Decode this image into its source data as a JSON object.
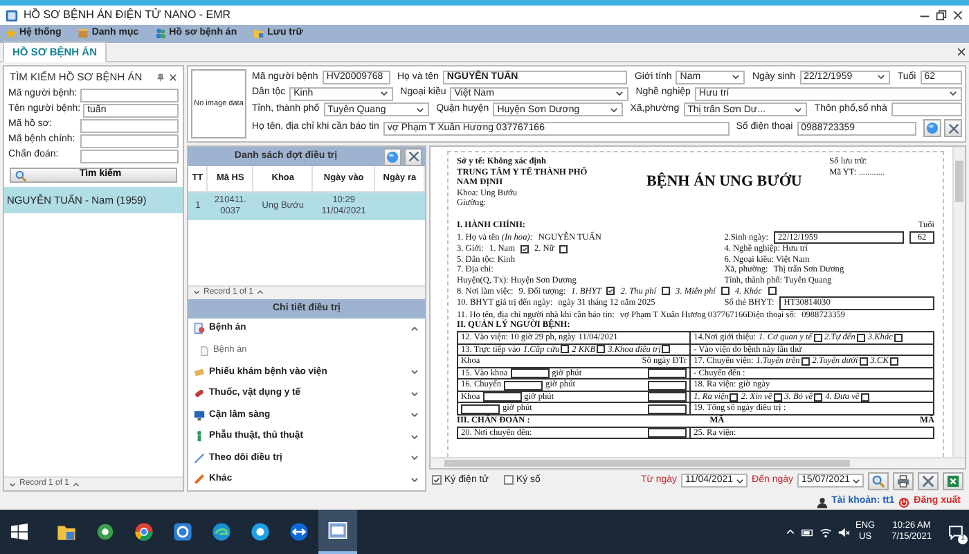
{
  "window": {
    "title": "HỒ SƠ BỆNH ÁN ĐIỆN TỬ NANO - EMR"
  },
  "menu": [
    {
      "label": "Hệ thống",
      "kind": "star"
    },
    {
      "label": "Danh mục",
      "kind": "book"
    },
    {
      "label": "Hồ sơ bệnh án",
      "kind": "people"
    },
    {
      "label": "Lưu trữ",
      "kind": "folder"
    }
  ],
  "tabs": [
    {
      "label": "HỒ SƠ BỆNH ÁN",
      "selected": true
    }
  ],
  "search_panel": {
    "title": "TÌM KIẾM HỒ SƠ BỆNH ÁN",
    "fields": [
      {
        "label": "Mã người bệnh:"
      },
      {
        "label": "Tên người bệnh:",
        "value": "tuấn"
      },
      {
        "label": "Mã hồ sơ:"
      },
      {
        "label": "Mã bệnh chính:"
      },
      {
        "label": "Chẩn đoán:"
      }
    ],
    "search_button": "Tìm kiếm",
    "results": [
      {
        "label": "NGUYỄN TUẤN - Nam (1959)",
        "selected": true
      }
    ],
    "pager": "Record 1 of 1"
  },
  "patient": {
    "photo": "No image data",
    "rows": [
      [
        {
          "label": "Mã người bệnh",
          "value": "HV20009768",
          "kind": "text"
        },
        {
          "label": "Họ và tên",
          "value": "NGUYỄN TUẤN",
          "kind": "text",
          "bold": true
        },
        {
          "label": "Giới tính",
          "value": "Nam",
          "kind": "select"
        },
        {
          "label": "Ngày sinh",
          "value": "22/12/1959",
          "kind": "select"
        },
        {
          "label": "Tuổi",
          "value": "62",
          "kind": "text"
        }
      ],
      [
        {
          "label": "Dân tộc",
          "value": "Kinh",
          "kind": "select"
        },
        {
          "label": "Ngoại kiều",
          "value": "Việt Nam",
          "kind": "select"
        },
        {
          "label": "Nghề nghiệp",
          "value": "Hưu trí",
          "kind": "select"
        }
      ],
      [
        {
          "label": "Tỉnh, thành phố",
          "value": "Tuyên Quang",
          "kind": "select"
        },
        {
          "label": "Quận huyện",
          "value": "Huyện Sơn Dương",
          "kind": "select"
        },
        {
          "label": "Xã,phường",
          "value": "Thị trấn Sơn Dư...",
          "kind": "select"
        },
        {
          "label": "Thôn phố,số nhà",
          "kind": "text"
        }
      ],
      [
        {
          "label": "Họ tên, địa chỉ khi cần báo tin",
          "value": "vợ Phạm T Xuân Hương 037767166",
          "kind": "text"
        },
        {
          "label": "Số điện thoại",
          "value": "0988723359",
          "kind": "text"
        }
      ]
    ]
  },
  "treatments": {
    "title": "Danh sách đợt điều trị",
    "columns": [
      "TT",
      "Mã HS",
      "Khoa",
      "Ngày vào",
      "Ngày ra"
    ],
    "rows": [
      {
        "cells": [
          "1",
          "210411.\n0037",
          "Ung Bướu",
          "10:29\n11/04/2021"
        ],
        "selected": true
      }
    ],
    "pager": "Record 1 of 1"
  },
  "details": {
    "title": "Chi tiết điều trị",
    "sections": [
      {
        "label": "Bệnh án",
        "kind": "record",
        "expanded": true,
        "children": [
          {
            "label": "Bệnh án"
          }
        ]
      },
      {
        "label": "Phiếu khám bệnh vào viện",
        "kind": "note",
        "expanded": false
      },
      {
        "label": "Thuốc, vật dụng y tế",
        "kind": "pill",
        "expanded": false
      },
      {
        "label": "Cận lâm sàng",
        "kind": "monitor",
        "expanded": false
      },
      {
        "label": "Phẫu thuật, thủ thuật",
        "kind": "figure",
        "expanded": false
      },
      {
        "label": "Theo dõi điều trị",
        "kind": "pen",
        "expanded": false
      },
      {
        "label": "Khác",
        "kind": "ruler",
        "expanded": false
      }
    ]
  },
  "document": {
    "header_left": [
      {
        "kind": "bold",
        "text": "Sở y tế: Không xác định"
      },
      {
        "kind": "bold",
        "text": "TRUNG TÂM Y TẾ THÀNH PHỐ"
      },
      {
        "kind": "bold",
        "text": "NAM ĐỊNH"
      },
      {
        "kind": "text",
        "text": "Khoa: Ung Bướu"
      },
      {
        "kind": "text",
        "text": "Giường:"
      }
    ],
    "title": "BỆNH ÁN UNG BƯỚU",
    "header_right": [
      {
        "kind": "text",
        "text": "Số lưu trữ:"
      },
      {
        "kind": "text",
        "text": "Mã YT: ............"
      }
    ],
    "lines": [
      {
        "kind": "plain",
        "left": [
          {
            "kind": "bold",
            "text": "I. HÀNH CHÍNH:"
          }
        ],
        "right": [
          {
            "kind": "end",
            "text": "Tuổi"
          }
        ]
      },
      {
        "kind": "plain",
        "left": [
          {
            "kind": "text",
            "text": "1. Họ và tên *(In hoa):*"
          },
          {
            "kind": "text",
            "text": "NGUYỄN TUẤN"
          }
        ],
        "right": [
          {
            "kind": "text",
            "text": "2.Sinh ngày:"
          },
          {
            "kind": "field",
            "text": "22/12/1959"
          },
          {
            "kind": "box",
            "text": "62"
          }
        ]
      },
      {
        "kind": "plain",
        "left": [
          {
            "kind": "text",
            "text": "3. Giới:"
          },
          {
            "kind": "check",
            "text": "1. Nam",
            "checked": true
          },
          {
            "kind": "check",
            "text": "2. Nữ",
            "checked": false
          }
        ],
        "right": [
          {
            "kind": "text",
            "text": "4. Nghề nghiệp: Hưu trí"
          }
        ]
      },
      {
        "kind": "plain",
        "left": [
          {
            "kind": "text",
            "text": "5. Dân tộc: Kinh"
          }
        ],
        "right": [
          {
            "kind": "text",
            "text": "6. Ngoại kiều: Việt Nam"
          }
        ]
      },
      {
        "kind": "plain",
        "left": [
          {
            "kind": "text",
            "text": "7. Địa chỉ:"
          }
        ],
        "right": [
          {
            "kind": "text",
            "text": "Xã, phường:"
          },
          {
            "kind": "text",
            "text": "Thị trấn Sơn Dương"
          }
        ]
      },
      {
        "kind": "plain",
        "left": [
          {
            "kind": "text",
            "text": "Huyện(Q, Tx): Huyện Sơn Dương"
          }
        ],
        "right": [
          {
            "kind": "text",
            "text": "Tỉnh, thành phố: Tuyên Quang"
          }
        ]
      },
      {
        "kind": "plain",
        "left": [
          {
            "kind": "text",
            "text": "8. Nơi làm việc:"
          },
          {
            "kind": "end",
            "text": "9. Đối tượng:"
          },
          {
            "kind": "check_italic",
            "text": "1. BHYT",
            "checked": true
          },
          {
            "kind": "check_italic",
            "text": "2. Thu phí",
            "checked": false
          },
          {
            "kind": "check_italic",
            "text": "3. Miễn phí",
            "checked": false
          },
          {
            "kind": "check_italic",
            "text": "4. Khác",
            "checked": false
          }
        ]
      },
      {
        "kind": "plain",
        "left": [
          {
            "kind": "text",
            "text": "10. BHYT giá trị đến ngày:"
          },
          {
            "kind": "text",
            "text": "ngày 31 tháng 12 năm 2025"
          }
        ],
        "right": [
          {
            "kind": "text",
            "text": "Số thẻ BHYT:"
          },
          {
            "kind": "field",
            "text": "HT30814030"
          }
        ]
      },
      {
        "kind": "plain",
        "left": [
          {
            "kind": "text",
            "text": "11. Họ tên, địa chỉ người nhà khi cần báo tin:"
          },
          {
            "kind": "text",
            "text": "vợ Phạm T Xuân Hương 037767166"
          }
        ],
        "right": [
          {
            "kind": "text",
            "text": "Điện thoại số:"
          },
          {
            "kind": "text",
            "text": "0988723359"
          }
        ]
      },
      {
        "kind": "plain",
        "left": [
          {
            "kind": "bold",
            "text": "II. QUẢN LÝ NGƯỜI BỆNH:"
          }
        ]
      },
      {
        "kind": "grid",
        "left": [
          {
            "kind": "text",
            "text": "12. Vào viện: 10  giờ  29  ph,  ngày"
          },
          {
            "kind": "text",
            "text": "11/04/2021"
          }
        ],
        "right": [
          {
            "kind": "text",
            "text": "14.Nơi giới thiệu:"
          },
          {
            "kind": "check_italic",
            "text": "1. Cơ quan y tế",
            "checked": false
          },
          {
            "kind": "check_italic",
            "text": "2.Tự đến",
            "checked": false
          },
          {
            "kind": "check_italic",
            "text": "3.Khác",
            "checked": false
          }
        ]
      },
      {
        "kind": "grid",
        "left": [
          {
            "kind": "text",
            "text": "13. Trực tiếp vào"
          },
          {
            "kind": "check_italic",
            "text": "1.Cấp cứu",
            "checked": false
          },
          {
            "kind": "check_italic",
            "text": "2 KKB",
            "checked": false
          },
          {
            "kind": "check_italic",
            "text": "3.Khoa điều trị",
            "checked": false
          }
        ],
        "right": [
          {
            "kind": "text",
            "text": "- Vào viện do bệnh này lần thứ"
          }
        ]
      },
      {
        "kind": "grid",
        "left": [
          {
            "kind": "text",
            "text": "Khoa"
          },
          {
            "kind": "end",
            "text": "Số ngày ĐTr"
          }
        ],
        "right": [
          {
            "kind": "text",
            "text": "17. Chuyển viện:"
          },
          {
            "kind": "check_italic",
            "text": "1.Tuyến trên",
            "checked": false
          },
          {
            "kind": "check_italic",
            "text": "2.Tuyến dưới",
            "checked": false
          },
          {
            "kind": "check_italic",
            "text": "3.CK",
            "checked": false
          }
        ]
      },
      {
        "kind": "grid",
        "left": [
          {
            "kind": "text",
            "text": "15. Vào khoa"
          },
          {
            "kind": "blank"
          },
          {
            "kind": "text",
            "text": "giờ"
          },
          {
            "kind": "text",
            "text": "phút"
          },
          {
            "kind": "blank"
          }
        ],
        "right": [
          {
            "kind": "text",
            "text": "- Chuyển đến :"
          }
        ]
      },
      {
        "kind": "grid",
        "left": [
          {
            "kind": "text",
            "text": "16. Chuyển"
          },
          {
            "kind": "blank"
          },
          {
            "kind": "text",
            "text": "giờ"
          },
          {
            "kind": "text",
            "text": "phút"
          },
          {
            "kind": "blank"
          }
        ],
        "right": [
          {
            "kind": "text",
            "text": "18. Ra viện:"
          },
          {
            "kind": "text",
            "text": "giờ"
          },
          {
            "kind": "text",
            "text": "ngày"
          }
        ]
      },
      {
        "kind": "grid",
        "left": [
          {
            "kind": "text",
            "text": "Khoa"
          },
          {
            "kind": "blank"
          },
          {
            "kind": "text",
            "text": "giờ"
          },
          {
            "kind": "text",
            "text": "phút"
          },
          {
            "kind": "blank"
          }
        ],
        "right": [
          {
            "kind": "check_italic",
            "text": "1. Ra viện",
            "checked": false
          },
          {
            "kind": "check_italic",
            "text": "2. Xin về",
            "checked": false
          },
          {
            "kind": "check_italic",
            "text": "3. Bỏ về",
            "checked": false
          },
          {
            "kind": "check_italic",
            "text": "4. Đưa về",
            "checked": false
          }
        ]
      },
      {
        "kind": "grid",
        "left": [
          {
            "kind": "blank"
          },
          {
            "kind": "text",
            "text": "giờ"
          },
          {
            "kind": "text",
            "text": "phút"
          },
          {
            "kind": "blank"
          }
        ],
        "right": [
          {
            "kind": "text",
            "text": "19. Tổng số ngày điều trị :"
          }
        ]
      },
      {
        "kind": "plain",
        "left": [
          {
            "kind": "bold",
            "text": "III. CHẨN ĐOÁN :"
          },
          {
            "kind": "bold_end",
            "text": "MÃ"
          }
        ],
        "right": [
          {
            "kind": "bold_end",
            "text": "MÃ"
          }
        ]
      },
      {
        "kind": "grid",
        "left": [
          {
            "kind": "text",
            "text": "20. Nơi chuyển đến:"
          },
          {
            "kind": "blank"
          }
        ],
        "right": [
          {
            "kind": "text",
            "text": "25. Ra viện:"
          }
        ]
      }
    ]
  },
  "footer_toolbar": {
    "checks": [
      {
        "label": "Ký điện tử",
        "checked": true
      },
      {
        "label": "Ký số",
        "checked": false
      }
    ],
    "from": {
      "label": "Từ ngày",
      "value": "11/04/2021"
    },
    "to": {
      "label": "Đến ngày",
      "value": "15/07/2021"
    }
  },
  "status": {
    "account": "Tài khoản: tt1",
    "logout": "Đăng xuất"
  },
  "taskbar": {
    "apps": [
      {
        "kind": "folder",
        "selected": false
      },
      {
        "kind": "gear",
        "selected": false
      },
      {
        "kind": "browser",
        "selected": false
      },
      {
        "kind": "window",
        "selected": false
      },
      {
        "kind": "edge",
        "selected": false
      },
      {
        "kind": "chat",
        "selected": false
      },
      {
        "kind": "remote",
        "selected": false
      },
      {
        "kind": "emr",
        "selected": true
      }
    ],
    "language": "ENG",
    "region": "US",
    "time": "10:26 AM",
    "date": "7/15/2021",
    "notifications": "1"
  }
}
